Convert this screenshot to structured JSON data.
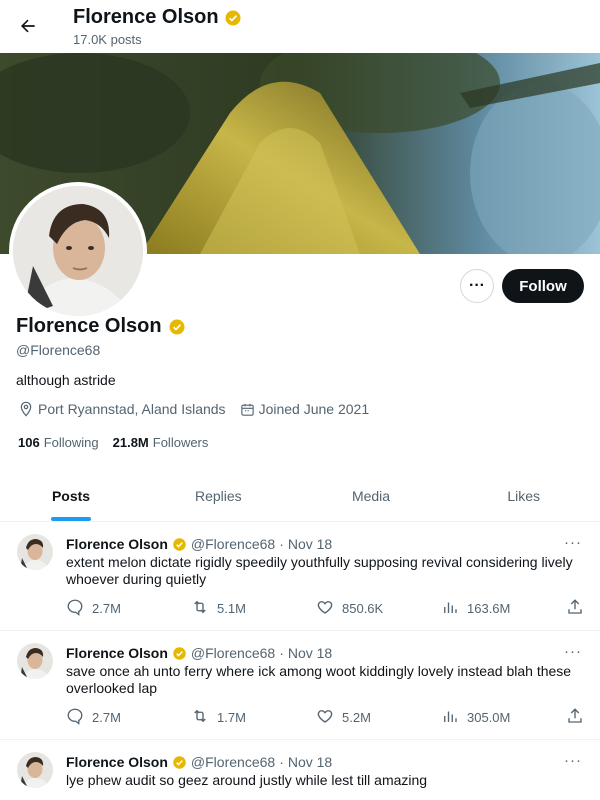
{
  "header": {
    "name": "Florence Olson",
    "post_count": "17.0K posts"
  },
  "profile": {
    "name": "Florence Olson",
    "handle": "@Florence68",
    "bio": "although astride",
    "location": "Port Ryannstad, Aland Islands",
    "joined": "Joined June 2021",
    "following_count": "106",
    "following_label": "Following",
    "followers_count": "21.8M",
    "followers_label": "Followers",
    "follow_button": "Follow",
    "more_button": "···"
  },
  "tabs": [
    "Posts",
    "Replies",
    "Media",
    "Likes"
  ],
  "colors": {
    "accent": "#1d9bf0",
    "verified": "#e6b800",
    "text": "#0f1419",
    "muted": "#536471"
  },
  "posts": [
    {
      "name": "Florence Olson",
      "handle": "@Florence68",
      "date": "Nov 18",
      "text": "extent melon dictate rigidly speedily youthfully supposing revival considering lively whoever during quietly",
      "replies": "2.7M",
      "reposts": "5.1M",
      "likes": "850.6K",
      "views": "163.6M"
    },
    {
      "name": "Florence Olson",
      "handle": "@Florence68",
      "date": "Nov 18",
      "text": "save once ah unto ferry where ick among woot kiddingly lovely instead blah these overlooked lap",
      "replies": "2.7M",
      "reposts": "1.7M",
      "likes": "5.2M",
      "views": "305.0M"
    },
    {
      "name": "Florence Olson",
      "handle": "@Florence68",
      "date": "Nov 18",
      "text": "lye phew audit so geez around justly while lest till amazing",
      "replies": "",
      "reposts": "",
      "likes": "",
      "views": ""
    }
  ]
}
